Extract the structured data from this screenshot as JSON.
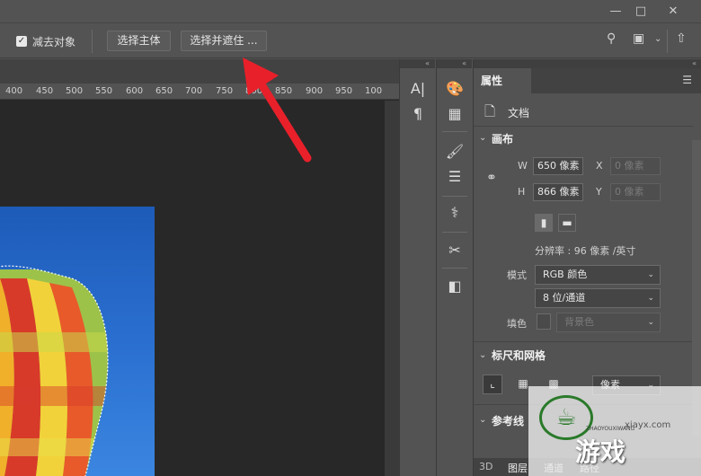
{
  "window": {
    "minimize_icon": "minimize-icon",
    "restore_icon": "restore-icon",
    "close_icon": "close-icon"
  },
  "options": {
    "subtract_label": "减去对象",
    "select_subject": "选择主体",
    "select_mask": "选择并遮住 ..."
  },
  "ruler": {
    "ticks": [
      "400",
      "450",
      "500",
      "550",
      "600",
      "650",
      "700",
      "750",
      "800",
      "850",
      "900",
      "950",
      "100"
    ]
  },
  "properties": {
    "tab": "属性",
    "doc_label": "文档",
    "canvas": {
      "title": "画布",
      "w_label": "W",
      "w_value": "650 像素",
      "h_label": "H",
      "h_value": "866 像素",
      "x_label": "X",
      "x_value": "0 像素",
      "y_label": "Y",
      "y_value": "0 像素",
      "resolution": "分辨率 : 96 像素 /英寸",
      "mode_label": "模式",
      "mode_value": "RGB 颜色",
      "bit_value": "8 位/通道",
      "fill_label": "填色",
      "fill_value": "背景色"
    },
    "rulers": {
      "title": "标尺和网格",
      "unit_value": "像素"
    },
    "guides": {
      "title": "参考线"
    },
    "bottom_tabs": [
      "3D",
      "图层",
      "通道",
      "路径"
    ]
  },
  "watermark": {
    "main": "游戏",
    "site": "xiayx.com",
    "sub": "ZHAOYOUXIWANG"
  },
  "colors": {
    "accent_arrow": "#e8202a",
    "sky": "#2a6fd0"
  }
}
